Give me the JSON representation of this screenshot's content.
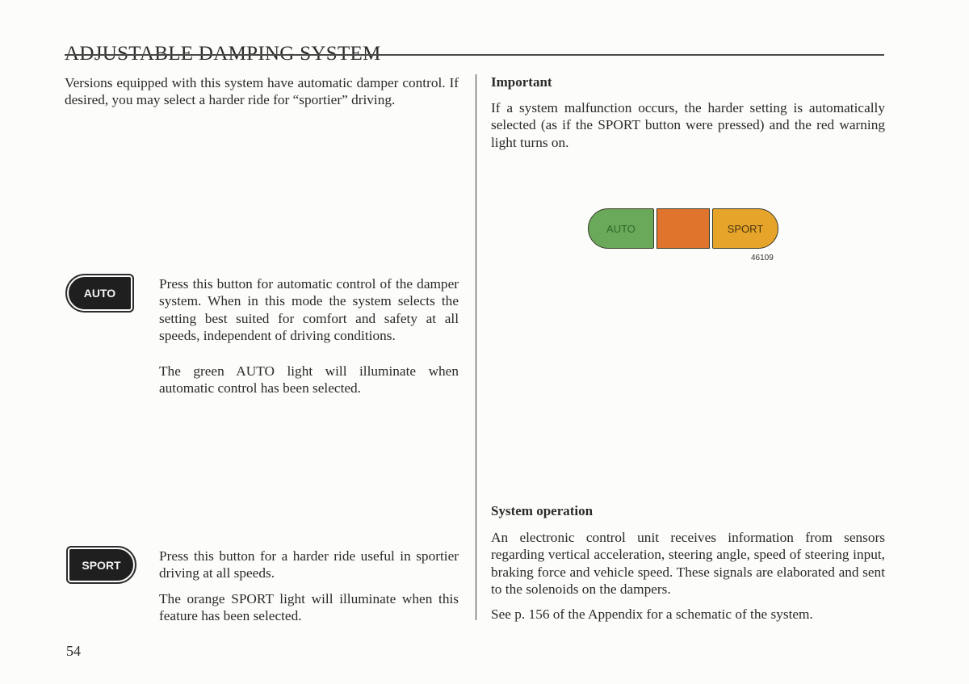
{
  "page": {
    "title": "ADJUSTABLE DAMPING SYSTEM",
    "page_number": "54"
  },
  "left_column": {
    "intro": "Versions equipped with this system have automatic damper control. If desired, you may select a harder ride for “sportier” driving.",
    "auto_button": {
      "icon": "auto-button-icon",
      "label": "AUTO",
      "description_1": "Press this button for automatic control of the damper system. When in this mode the system selects the setting best suited for comfort and safety at all speeds, independent of driving conditions.",
      "description_2": "The green AUTO light will illuminate when automatic control has been selected."
    },
    "sport_button": {
      "icon": "sport-button-icon",
      "label": "SPORT",
      "description_1": "Press this button for a harder ride useful in sportier driving at all speeds.",
      "description_2": "The orange SPORT light will illuminate when this feature has been selected."
    }
  },
  "right_column": {
    "important": {
      "heading": "Important",
      "text": "If a system malfunction occurs, the harder setting is automatically selected (as if the SPORT button were pressed) and the red warning light turns on."
    },
    "indicator_figure": {
      "lights": [
        {
          "label": "AUTO",
          "color": "#6aa85a"
        },
        {
          "label": "",
          "color": "#e0742c"
        },
        {
          "label": "SPORT",
          "color": "#e6a52a"
        }
      ],
      "figure_number": "46109"
    },
    "system_operation": {
      "heading": "System operation",
      "text_1": "An electronic control unit receives information from sensors regarding vertical acceleration, steering angle, speed of steering input, braking force and vehicle speed. These signals are elaborated and sent to the solenoids on the dampers.",
      "text_2": "See p. 156 of the Appendix for a schematic of the system."
    }
  }
}
